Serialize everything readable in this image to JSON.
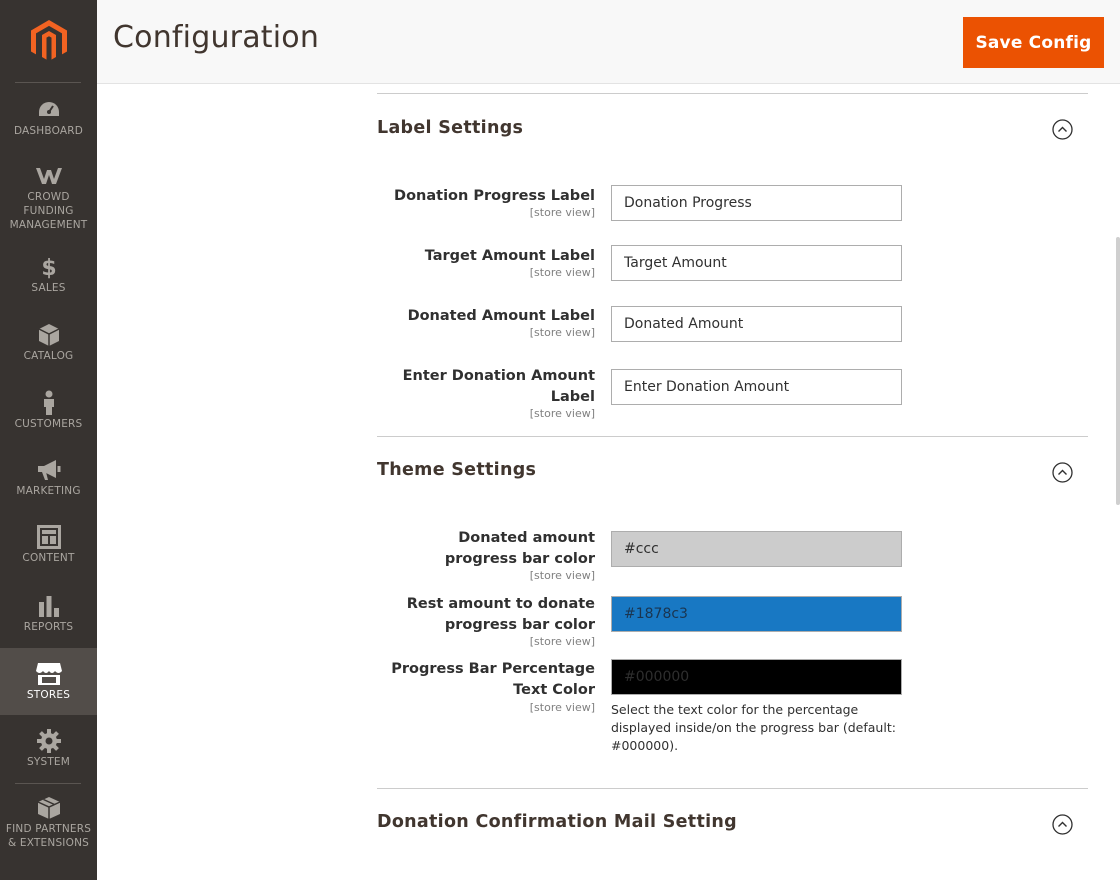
{
  "header": {
    "title": "Configuration",
    "save_label": "Save Config"
  },
  "brand": {
    "accent": "#eb5202",
    "sidebar_bg": "#373330"
  },
  "sidebar": {
    "items": [
      {
        "label": "DASHBOARD",
        "icon": "dashboard-icon"
      },
      {
        "label": "CROWD\nFUNDING\nMANAGEMENT",
        "icon": "crowd-funding-icon"
      },
      {
        "label": "SALES",
        "icon": "dollar-icon"
      },
      {
        "label": "CATALOG",
        "icon": "box-icon"
      },
      {
        "label": "CUSTOMERS",
        "icon": "person-icon"
      },
      {
        "label": "MARKETING",
        "icon": "megaphone-icon"
      },
      {
        "label": "CONTENT",
        "icon": "layout-icon"
      },
      {
        "label": "REPORTS",
        "icon": "bar-chart-icon"
      },
      {
        "label": "STORES",
        "icon": "store-icon",
        "active": true
      },
      {
        "label": "SYSTEM",
        "icon": "gear-icon"
      },
      {
        "label": "FIND PARTNERS\n& EXTENSIONS",
        "icon": "blocks-icon"
      }
    ]
  },
  "label_settings": {
    "title": "Label Settings",
    "scope": "[store view]",
    "fields": [
      {
        "label": "Donation Progress Label",
        "value": "Donation Progress"
      },
      {
        "label": "Target Amount Label",
        "value": "Target Amount"
      },
      {
        "label": "Donated Amount Label",
        "value": "Donated Amount"
      },
      {
        "label": "Enter Donation Amount Label",
        "value": "Enter Donation Amount"
      }
    ]
  },
  "theme_settings": {
    "title": "Theme Settings",
    "scope": "[store view]",
    "fields": [
      {
        "label": "Donated amount progress bar color",
        "value": "#ccc",
        "bg": "#cccccc",
        "fg": "#303030"
      },
      {
        "label": "Rest amount to donate progress bar color",
        "value": "#1878c3",
        "bg": "#1878c3",
        "fg": "#1a3550"
      },
      {
        "label": "Progress Bar Percentage Text Color",
        "value": "#000000",
        "bg": "#000000",
        "fg": "#2e2e2e"
      }
    ],
    "note": "Select the text color for the percentage displayed inside/on the progress bar (default: #000000)."
  },
  "mail_settings": {
    "title": "Donation Confirmation Mail Setting"
  }
}
